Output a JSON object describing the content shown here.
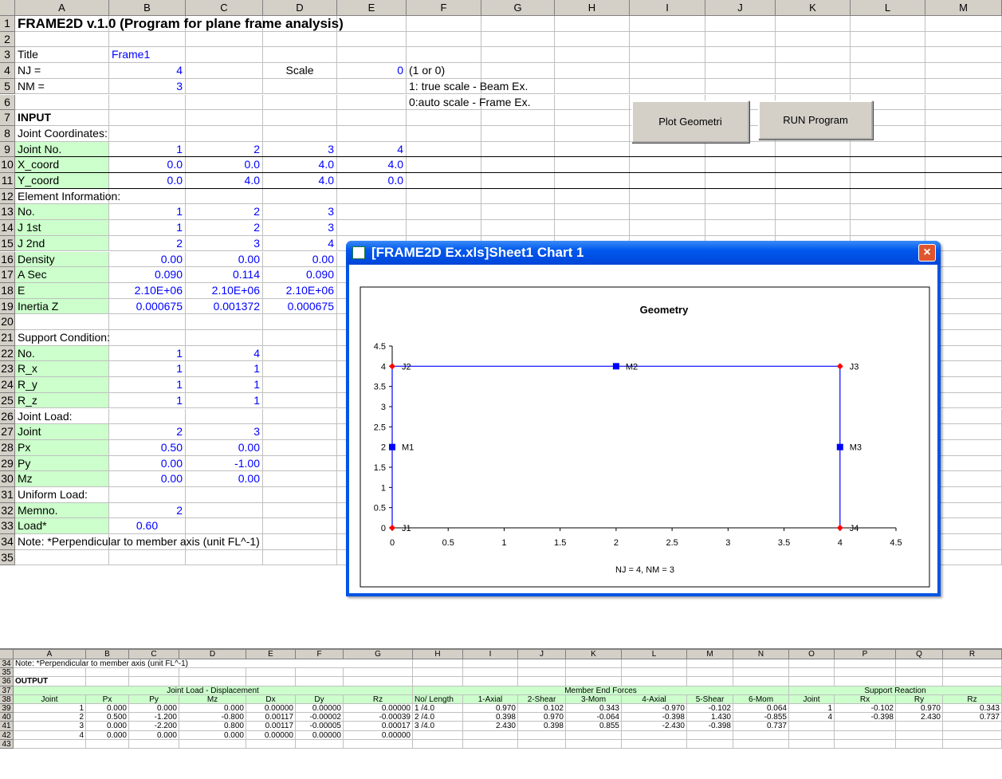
{
  "window": {
    "title": "[FRAME2D Ex.xls]Sheet1 Chart 1",
    "close": "×"
  },
  "columns": [
    "A",
    "B",
    "C",
    "D",
    "E",
    "F",
    "G",
    "H",
    "I",
    "J",
    "K",
    "L",
    "M"
  ],
  "rows": [
    "1",
    "2",
    "3",
    "4",
    "5",
    "6",
    "7",
    "8",
    "9",
    "10",
    "11",
    "12",
    "13",
    "14",
    "15",
    "16",
    "17",
    "18",
    "19",
    "20",
    "21",
    "22",
    "23",
    "24",
    "25",
    "26",
    "27",
    "28",
    "29",
    "30",
    "31",
    "32",
    "33",
    "34",
    "35"
  ],
  "r1": "FRAME2D v.1.0 (Program for plane frame analysis)",
  "r3": {
    "a": "Title",
    "b": "Frame1"
  },
  "r4": {
    "a": "NJ =",
    "b": "4",
    "d": "Scale",
    "e": "0",
    "f": "(1 or 0)"
  },
  "r5": {
    "a": "NM =",
    "b": "3",
    "f": "1: true scale - Beam Ex."
  },
  "r6": {
    "f": "0:auto scale - Frame Ex."
  },
  "r7": "INPUT",
  "r8": "Joint Coordinates:",
  "r9": {
    "a": "Joint No.",
    "v": [
      "1",
      "2",
      "3",
      "4"
    ]
  },
  "r10": {
    "a": "X_coord",
    "v": [
      "0.0",
      "0.0",
      "4.0",
      "4.0"
    ]
  },
  "r11": {
    "a": "Y_coord",
    "v": [
      "0.0",
      "4.0",
      "4.0",
      "0.0"
    ]
  },
  "r12": "Element Information:",
  "r13": {
    "a": "No.",
    "v": [
      "1",
      "2",
      "3"
    ]
  },
  "r14": {
    "a": "J 1st",
    "v": [
      "1",
      "2",
      "3"
    ]
  },
  "r15": {
    "a": "J 2nd",
    "v": [
      "2",
      "3",
      "4"
    ]
  },
  "r16": {
    "a": "Density",
    "v": [
      "0.00",
      "0.00",
      "0.00"
    ]
  },
  "r17": {
    "a": "A Sec",
    "v": [
      "0.090",
      "0.114",
      "0.090"
    ]
  },
  "r18": {
    "a": "E",
    "v": [
      "2.10E+06",
      "2.10E+06",
      "2.10E+06"
    ]
  },
  "r19": {
    "a": "Inertia Z",
    "v": [
      "0.000675",
      "0.001372",
      "0.000675"
    ]
  },
  "r21": "Support Condition:",
  "r22": {
    "a": "No.",
    "v": [
      "1",
      "4"
    ]
  },
  "r23": {
    "a": "R_x",
    "v": [
      "1",
      "1"
    ]
  },
  "r24": {
    "a": "R_y",
    "v": [
      "1",
      "1"
    ]
  },
  "r25": {
    "a": "R_z",
    "v": [
      "1",
      "1"
    ]
  },
  "r26": "Joint Load:",
  "r27": {
    "a": "Joint",
    "v": [
      "2",
      "3"
    ]
  },
  "r28": {
    "a": "Px",
    "v": [
      "0.50",
      "0.00"
    ]
  },
  "r29": {
    "a": "Py",
    "v": [
      "0.00",
      "-1.00"
    ]
  },
  "r30": {
    "a": "Mz",
    "v": [
      "0.00",
      "0.00"
    ]
  },
  "r31": "Uniform Load:",
  "r32": {
    "a": "Memno.",
    "v": [
      "2"
    ]
  },
  "r33": {
    "a": "Load*",
    "v": [
      "0.60"
    ]
  },
  "r34": "Note: *Perpendicular to member axis (unit FL^-1)",
  "buttons": {
    "plot": "Plot Geometri",
    "run": "RUN Program"
  },
  "chart_data": {
    "type": "scatter",
    "title": "Geometry",
    "xlabel": "NJ = 4, NM = 3",
    "xlim": [
      0,
      4.5
    ],
    "ylim": [
      0,
      4.5
    ],
    "xticks": [
      "0",
      "0.5",
      "1",
      "1.5",
      "2",
      "2.5",
      "3",
      "3.5",
      "4",
      "4.5"
    ],
    "yticks": [
      "0",
      "0.5",
      "1",
      "1.5",
      "2",
      "2.5",
      "3",
      "3.5",
      "4",
      "4.5"
    ],
    "lines": [
      {
        "x": [
          0,
          0,
          4,
          4
        ],
        "y": [
          0,
          4,
          4,
          0
        ]
      }
    ],
    "joints": [
      {
        "label": "J1",
        "x": 0,
        "y": 0
      },
      {
        "label": "J2",
        "x": 0,
        "y": 4
      },
      {
        "label": "J3",
        "x": 4,
        "y": 4
      },
      {
        "label": "J4",
        "x": 4,
        "y": 0
      }
    ],
    "members": [
      {
        "label": "M1",
        "x": 0,
        "y": 2
      },
      {
        "label": "M2",
        "x": 2,
        "y": 4
      },
      {
        "label": "M3",
        "x": 4,
        "y": 2
      }
    ],
    "colors": {
      "line": "#0000ff",
      "joint": "#ff0000",
      "member": "#0000ff"
    }
  },
  "lower": {
    "cols": [
      "A",
      "B",
      "C",
      "D",
      "E",
      "F",
      "G",
      "H",
      "I",
      "J",
      "K",
      "L",
      "M",
      "N",
      "O",
      "P",
      "Q",
      "R"
    ],
    "rows": [
      "34",
      "35",
      "36",
      "37",
      "38",
      "39",
      "40",
      "41",
      "42",
      "43"
    ],
    "note": "Note: *Perpendicular to member axis (unit FL^-1)",
    "output": "OUTPUT",
    "groups": [
      "Joint Load - Displacement",
      "Member End Forces",
      "Support Reaction"
    ],
    "headers": [
      "Joint",
      "Px",
      "Py",
      "Mz",
      "Dx",
      "Dy",
      "Rz",
      "No/ Length",
      "1-Axial",
      "2-Shear",
      "3-Mom",
      "4-Axial",
      "5-Shear",
      "6-Mom",
      "Joint",
      "Rx",
      "Ry",
      "Rz"
    ],
    "data": [
      [
        "1",
        "0.000",
        "0.000",
        "0.000",
        "0.00000",
        "0.00000",
        "0.00000",
        "1 /4.0",
        "0.970",
        "0.102",
        "0.343",
        "-0.970",
        "-0.102",
        "0.064",
        "1",
        "-0.102",
        "0.970",
        "0.343"
      ],
      [
        "2",
        "0.500",
        "-1.200",
        "-0.800",
        "0.00117",
        "-0.00002",
        "-0.00039",
        "2 /4.0",
        "0.398",
        "0.970",
        "-0.064",
        "-0.398",
        "1.430",
        "-0.855",
        "4",
        "-0.398",
        "2.430",
        "0.737"
      ],
      [
        "3",
        "0.000",
        "-2.200",
        "0.800",
        "0.00117",
        "-0.00005",
        "0.00017",
        "3 /4.0",
        "2.430",
        "0.398",
        "0.855",
        "-2.430",
        "-0.398",
        "0.737",
        "",
        "",
        "",
        ""
      ],
      [
        "4",
        "0.000",
        "0.000",
        "0.000",
        "0.00000",
        "0.00000",
        "0.00000",
        "",
        "",
        "",
        "",
        "",
        "",
        "",
        "",
        "",
        "",
        ""
      ]
    ]
  }
}
